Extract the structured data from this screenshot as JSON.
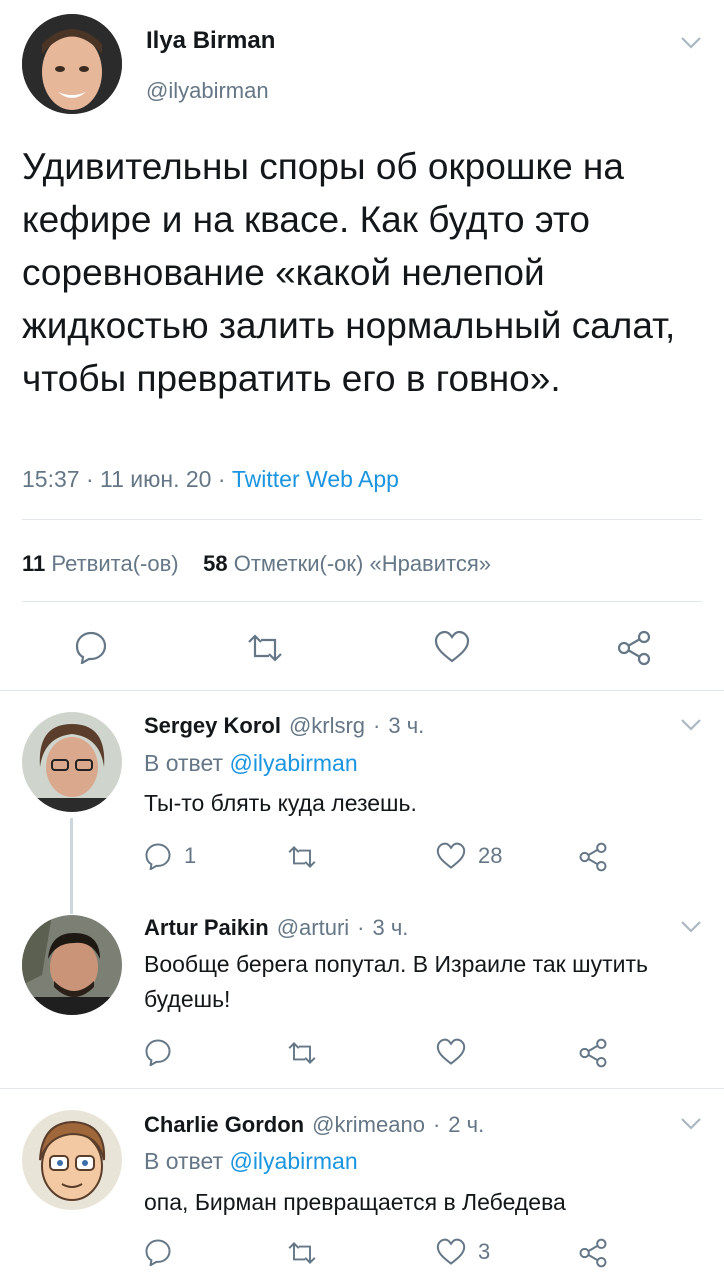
{
  "tweet": {
    "author_name": "Ilya Birman",
    "author_handle": "@ilyabirman",
    "text": "Удивительны споры об окрошке на кефире и на квасе. Как будто это соревнование «какой нелепой жидкостью залить нормальный салат, чтобы превратить его в говно».",
    "time": "15:37",
    "date": "11 июн. 20",
    "source": "Twitter Web App",
    "retweet_count": "11",
    "retweet_label": "Ретвита(-ов)",
    "like_count": "58",
    "like_label": "Отметки(-ок) «Нравится»"
  },
  "replies": [
    {
      "name": "Sergey Korol",
      "handle": "@krlsrg",
      "time": "3 ч.",
      "replying_prefix": "В ответ",
      "replying_to": "@ilyabirman",
      "text": "Ты-то блять куда лезешь.",
      "reply_count": "1",
      "retweet_count": "",
      "like_count": "28"
    },
    {
      "name": "Artur Paikin",
      "handle": "@arturi",
      "time": "3 ч.",
      "text": "Вообще берега попутал. В Израиле так шутить будешь!",
      "reply_count": "",
      "retweet_count": "",
      "like_count": ""
    },
    {
      "name": "Charlie Gordon",
      "handle": "@krimeano",
      "time": "2 ч.",
      "replying_prefix": "В ответ",
      "replying_to": "@ilyabirman",
      "text": "опа, Бирман превращается в Лебедева",
      "reply_count": "",
      "retweet_count": "",
      "like_count": "3"
    }
  ],
  "sep": "·",
  "colors": {
    "text": "#14171a",
    "secondary": "#657786",
    "link": "#1b95e0",
    "divider": "#e1e8ed"
  },
  "icons": [
    "chevron-down-icon",
    "reply-icon",
    "retweet-icon",
    "like-icon",
    "share-icon"
  ]
}
